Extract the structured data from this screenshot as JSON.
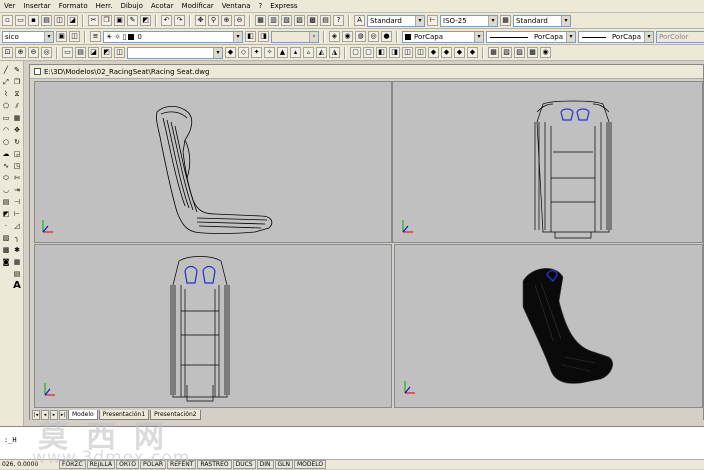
{
  "menu": [
    "Ver",
    "Insertar",
    "Formato",
    "Herr.",
    "Dibujo",
    "Acotar",
    "Modificar",
    "Ventana",
    "?",
    "Express"
  ],
  "styles": {
    "text_style": "Standard",
    "dim_style": "ISO-25",
    "table_style": "Standard"
  },
  "layers": {
    "workspace": "sico",
    "current_layer": "0",
    "color": "PorCapa",
    "linetype": "PorCapa",
    "lineweight": "PorCapa",
    "plotstyle": "PorColor"
  },
  "drawing": {
    "title": "E:\\3D\\Modelos\\02_RacingSeat\\Racing Seat.dwg"
  },
  "tabs": [
    "Modelo",
    "Presentación1",
    "Presentación2"
  ],
  "command": {
    "line2": ":_H"
  },
  "status": {
    "coords": "026, 0.0000",
    "buttons": [
      "FORZC",
      "REJILLA",
      "ORTO",
      "POLAR",
      "REFENT",
      "RASTREO",
      "DUCS",
      "DIN",
      "GLN",
      "MODELO"
    ]
  },
  "watermark": {
    "chinese": "莫西网",
    "url": "www.3dmox.com"
  },
  "colors": {
    "viewport_bg": "#c0c0c0",
    "accent_blue": "#2233cc",
    "titlebar_bg": "#ece9d8"
  }
}
